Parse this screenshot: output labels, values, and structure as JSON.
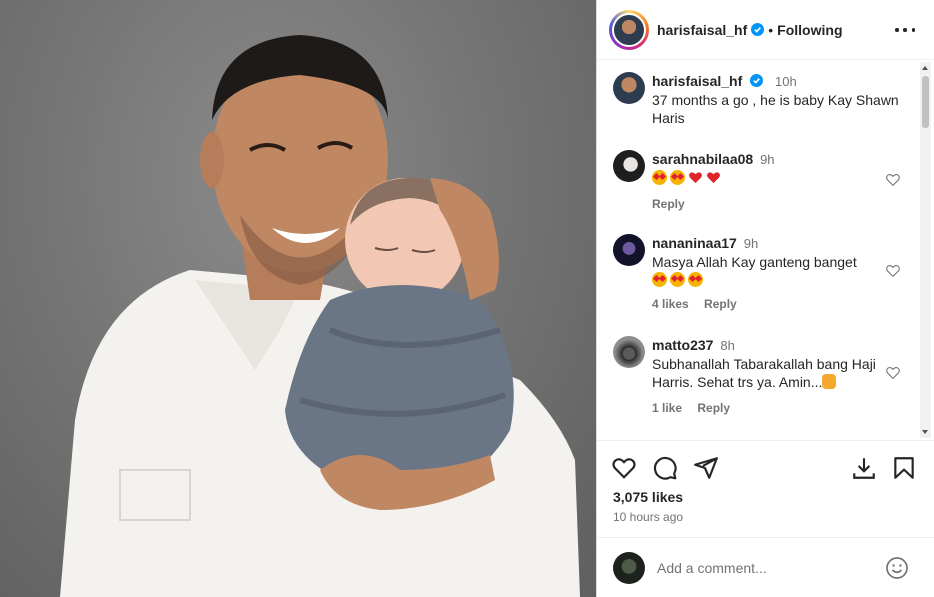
{
  "post": {
    "username": "harisfaisal_hf",
    "separator": "•",
    "follow_status": "Following"
  },
  "caption": {
    "username": "harisfaisal_hf",
    "time": "10h",
    "text": "37 months a go , he is baby Kay Shawn Haris"
  },
  "comments": [
    {
      "username": "sarahnabilaa08",
      "time": "9h",
      "text": "",
      "emojis": [
        "star-eyes",
        "star-eyes",
        "red-heart",
        "red-heart"
      ],
      "likes": "",
      "reply": "Reply"
    },
    {
      "username": "nananinaa17",
      "time": "9h",
      "text": "Masya Allah Kay ganteng banget",
      "emojis": [
        "star-eyes",
        "star-eyes",
        "star-eyes"
      ],
      "likes": "4 likes",
      "reply": "Reply"
    },
    {
      "username": "matto237",
      "time": "8h",
      "text": "Subhanallah Tabarakallah bang Haji Harris. Sehat trs ya. Amin...",
      "emojis": [
        "palms-up"
      ],
      "likes": "1 like",
      "reply": "Reply"
    }
  ],
  "stats": {
    "likes": "3,075 likes",
    "posted": "10 hours ago"
  },
  "composer": {
    "placeholder": "Add a comment..."
  },
  "colors": {
    "verified": "#0095f6",
    "text": "#262626",
    "secondary": "#737373",
    "heart_emoji": "#e0242c"
  }
}
